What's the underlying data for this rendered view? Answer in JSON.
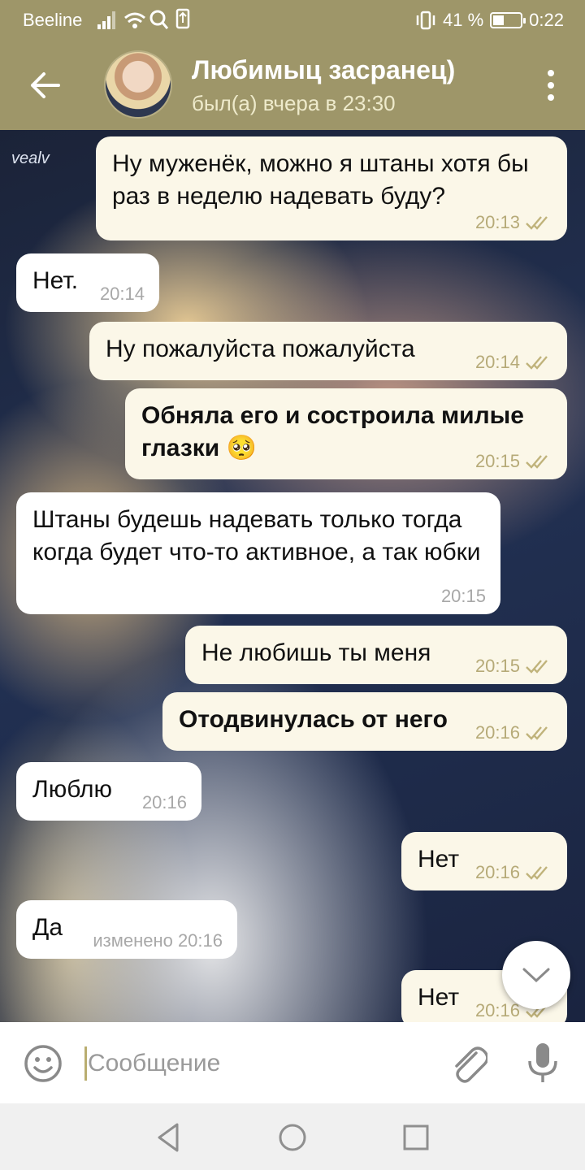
{
  "status_bar": {
    "carrier": "Beeline",
    "battery_text": "41 %",
    "battery_level": 0.41,
    "time": "0:22"
  },
  "header": {
    "contact_name": "Любимыц засранец)",
    "last_seen": "был(а) вчера в 23:30",
    "back_icon": "arrow-left-icon",
    "menu_icon": "more-vertical-icon"
  },
  "wallpaper": {
    "watermark": "vealv"
  },
  "messages": [
    {
      "direction": "out",
      "text": "Ну муженёк, можно я штаны хотя бы раз в неделю надевать буду?",
      "time": "20:13",
      "read": true
    },
    {
      "direction": "in",
      "text": "Нет.",
      "time": "20:14"
    },
    {
      "direction": "out",
      "text": "Ну пожалуйста пожалуйста",
      "time": "20:14",
      "read": true
    },
    {
      "direction": "out",
      "text": "Обняла его и состроила милые глазки 🥺",
      "time": "20:15",
      "read": true,
      "bold": true
    },
    {
      "direction": "in",
      "text": "Штаны будешь надевать только тогда когда будет что-то активное, а так юбки",
      "time": "20:15"
    },
    {
      "direction": "out",
      "text": "Не любишь ты меня",
      "time": "20:15",
      "read": true
    },
    {
      "direction": "out",
      "text": "Отодвинулась от него",
      "time": "20:16",
      "read": true,
      "bold": true
    },
    {
      "direction": "in",
      "text": "Люблю",
      "time": "20:16"
    },
    {
      "direction": "out",
      "text": "Нет",
      "time": "20:16",
      "read": true
    },
    {
      "direction": "in",
      "text": "Да",
      "time": "изменено 20:16"
    },
    {
      "direction": "out",
      "text": "Нет",
      "time": "20:16",
      "read": true
    }
  ],
  "composer": {
    "placeholder": "Сообщение",
    "emoji_icon": "smiley-icon",
    "attach_icon": "paperclip-icon",
    "mic_icon": "microphone-icon"
  },
  "colors": {
    "header": "#9e9669",
    "outgoing_bubble": "#fbf7e8",
    "incoming_bubble": "#ffffff",
    "time_outgoing": "#b6aa78"
  }
}
